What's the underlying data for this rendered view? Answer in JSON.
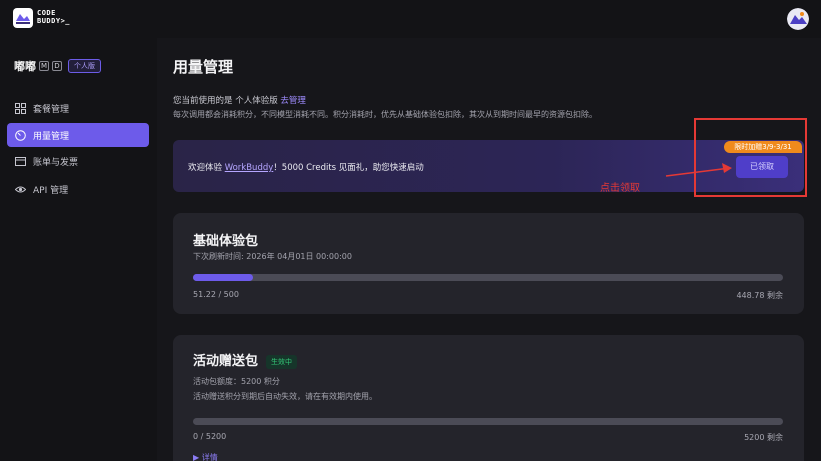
{
  "app": {
    "logo_text_line1": "CODE",
    "logo_text_line2": "BUDDY>_"
  },
  "sidebar": {
    "user_name": "嘟嘟",
    "badges": [
      "M",
      "D"
    ],
    "plan": "个人版",
    "items": [
      {
        "label": "套餐管理",
        "icon": "grid-icon",
        "active": false
      },
      {
        "label": "用量管理",
        "icon": "gauge-icon",
        "active": true
      },
      {
        "label": "账单与发票",
        "icon": "invoice-icon",
        "active": false
      },
      {
        "label": "API 管理",
        "icon": "eye-icon",
        "active": false
      }
    ]
  },
  "main": {
    "title": "用量管理",
    "version_prefix": "您当前使用的是 个人体验版",
    "version_link": "去管理",
    "description": "每次调用都会消耗积分，不同模型消耗不同。积分消耗时，优先从基础体验包扣除，其次从到期时间最早的资源包扣除。",
    "promo": {
      "text_prefix": "欢迎体验 ",
      "link": "WorkBuddy",
      "text_suffix": "！5000 Credits 见面礼，助您快速启动",
      "tag": "限时加赠3/9-3/31",
      "button_label": "已领取"
    },
    "annotation_label": "点击领取",
    "basic_pack": {
      "title": "基础体验包",
      "refresh_label": "下次刷新时间: 2026年 04月01日 00:00:00",
      "used_text": "51.22 / 500",
      "remaining_text": "448.78 剩余",
      "used": 51.22,
      "total": 500
    },
    "event_pack": {
      "title": "活动赠送包",
      "status": "生效中",
      "quota_label": "活动包额度：5200 积分",
      "note": "活动赠送积分到期后自动失效，请在有效期内使用。",
      "used_text": "0 / 5200",
      "remaining_text": "5200 剩余",
      "used": 0,
      "total": 5200,
      "details_label": "▶ 详情"
    }
  },
  "colors": {
    "accent": "#6d5bea",
    "annotation": "#e53935",
    "tag": "#f08a1c",
    "status_green": "#34c777"
  }
}
